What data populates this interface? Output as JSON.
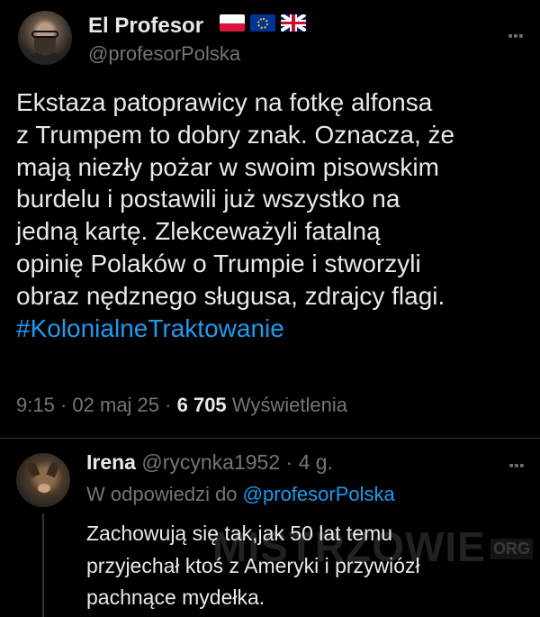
{
  "tweet": {
    "author_name": "El Profesor",
    "author_flags": [
      "flag-poland-icon",
      "flag-eu-icon",
      "flag-uk-icon"
    ],
    "handle": "@profesorPolska",
    "text_lines": [
      "Ekstaza patoprawicy na fotkę alfonsa",
      "z Trumpem to dobry znak. Oznacza, że",
      "mają niezły pożar w swoim pisowskim",
      "burdelu i postawili już wszystko na",
      "jedną kartę. Zlekceważyli fatalną",
      "opinię Polaków o Trumpie i stworzyli",
      "obraz nędznego sługusa, zdrajcy flagi."
    ],
    "hashtag": "#KolonialneTraktowanie",
    "time": "9:15",
    "sep1": "·",
    "date": "02 maj 25",
    "sep2": "·",
    "views_count": "6 705",
    "views_label": "Wyświetlenia",
    "more_icon": "⋮"
  },
  "reply": {
    "author_name": "Irena",
    "handle": "@rycynka1952",
    "sep": "·",
    "age": "4 g.",
    "in_reply_prefix": "W odpowiedzi do",
    "in_reply_handle": "@profesorPolska",
    "text_lines": [
      "Zachowują się tak,jak 50 lat temu",
      "przyjechał ktoś z Ameryki i przywiózł",
      "pachnące mydełka."
    ],
    "more_icon": "⋮"
  },
  "watermark": {
    "text": "MISTRZOWIE",
    "suffix": "ORG"
  },
  "colors": {
    "background": "#000000",
    "text": "#e7e9ea",
    "secondary": "#71767b",
    "link": "#1d9bf0",
    "divider": "#2f3336"
  }
}
